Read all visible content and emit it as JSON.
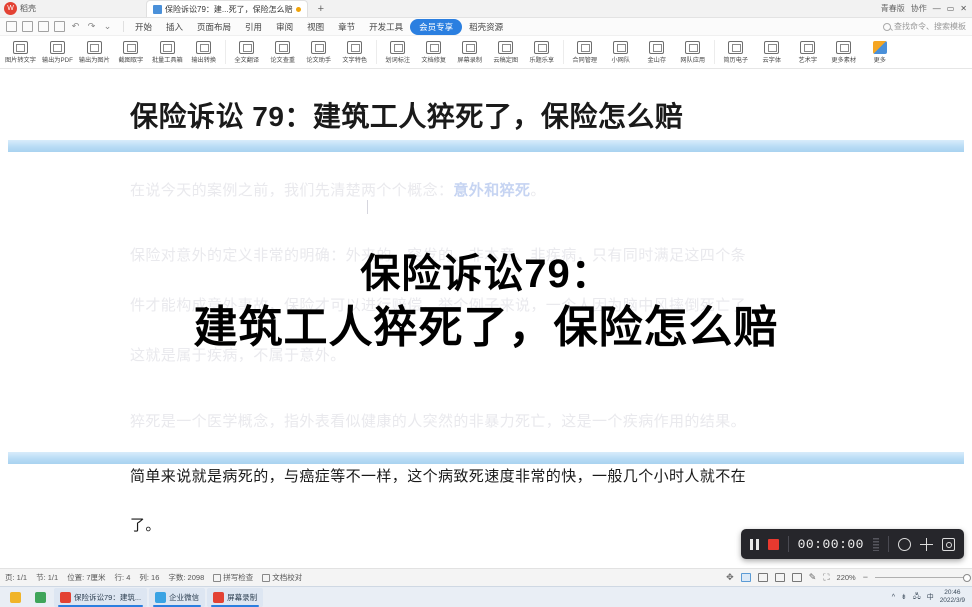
{
  "window": {
    "app_badge": "W",
    "app_label": "稻壳",
    "document_tab": "保险诉讼79：建...死了，保险怎么赔",
    "new_tab_label": "+",
    "share_label": "青春版",
    "collab_label": "协作",
    "minimize": "—",
    "maximize": "▭",
    "close": "✕"
  },
  "menu": {
    "items": [
      {
        "label": "开始",
        "vip": false
      },
      {
        "label": "插入",
        "vip": false
      },
      {
        "label": "页面布局",
        "vip": false
      },
      {
        "label": "引用",
        "vip": false
      },
      {
        "label": "审阅",
        "vip": false
      },
      {
        "label": "视图",
        "vip": false
      },
      {
        "label": "章节",
        "vip": false
      },
      {
        "label": "开发工具",
        "vip": false
      },
      {
        "label": "会员专享",
        "vip": true
      },
      {
        "label": "稻壳资源",
        "vip": false
      }
    ],
    "search_placeholder": "查找命令、搜索模板"
  },
  "ribbon": {
    "items": [
      {
        "label": "图片转文字"
      },
      {
        "label": "输出为PDF"
      },
      {
        "label": "输出为图片"
      },
      {
        "label": "截图取字"
      },
      {
        "label": "批量工具箱"
      },
      {
        "label": "输出转换"
      },
      {
        "label": "全文翻译"
      },
      {
        "label": "论文查重"
      },
      {
        "label": "论文助手"
      },
      {
        "label": "文字特色"
      },
      {
        "label": "划词标注"
      },
      {
        "label": "文档修复"
      },
      {
        "label": "屏幕录制"
      },
      {
        "label": "云稿定图"
      },
      {
        "label": "乐题乐享"
      },
      {
        "label": "合同管理"
      },
      {
        "label": "小网队"
      },
      {
        "label": "金山存"
      },
      {
        "label": "网队应用"
      },
      {
        "label": "简历电子"
      },
      {
        "label": "云字体"
      },
      {
        "label": "艺术字"
      },
      {
        "label": "更多素材"
      },
      {
        "label": "更多"
      }
    ]
  },
  "document": {
    "title": "保险诉讼 79：建筑工人猝死了，保险怎么赔",
    "lines": [
      {
        "text": "在说今天的案例之前，我们先清楚两个个概念：",
        "highlight": "意外和猝死",
        "tail": "。",
        "faded": true
      },
      {
        "text": "保险对意外的定义非常的明确：外来的、突发的、非本意、非疾病，只有同时满足这四个条",
        "faded": true
      },
      {
        "text": "件才能构成意外事故，保险才可以进行赔偿。举个例子来说，一个人因为脑中风摔倒死亡了，",
        "faded": true
      },
      {
        "text": "这就是属于疾病，不属于意外。",
        "faded": true
      },
      {
        "text": "猝死是一个医学概念，指外表看似健康的人突然的非暴力死亡，这是一个疾病作用的结果。",
        "faded": true
      },
      {
        "text": "简单来说就是病死的，与癌症等不一样，这个病致死速度非常的快，一般几个小时人就不在",
        "faded": false
      },
      {
        "text": "了。",
        "faded": false
      }
    ]
  },
  "overlay": {
    "line1": "保险诉讼79：",
    "line2": "建筑工人猝死了，保险怎么赔"
  },
  "recorder": {
    "timer": "00:00:00",
    "pause_label": "暂停",
    "stop_label": "停止",
    "mic_label": "麦克风",
    "expand_label": "展开",
    "camera_label": "截图"
  },
  "statusbar": {
    "page": "页: 1/1",
    "section": "节: 1/1",
    "position": "位置: 7厘米",
    "row": "行: 4",
    "col": "列: 16",
    "wordcount": "字数: 2098",
    "spellcheck": "拼写检查",
    "proofread": "文档校对",
    "zoom": "220%",
    "zoom_out": "−",
    "zoom_in": "+"
  },
  "taskbar": {
    "items": [
      {
        "label": "",
        "color": "#f0b429",
        "open": false
      },
      {
        "label": "",
        "color": "#3fa55a",
        "open": false
      },
      {
        "label": "保险诉讼79：建筑...",
        "color": "#e34234",
        "open": true
      },
      {
        "label": "企业微信",
        "color": "#3aa3e3",
        "open": true
      },
      {
        "label": "屏幕录制",
        "color": "#e34234",
        "open": true
      }
    ],
    "clock_time": "20:46",
    "clock_date": "2022/3/9"
  },
  "colors": {
    "accent": "#2b7fe0",
    "record_red": "#e8392f",
    "band_blue": "#b9dcf5",
    "faded_text": "#e9e9ed"
  }
}
